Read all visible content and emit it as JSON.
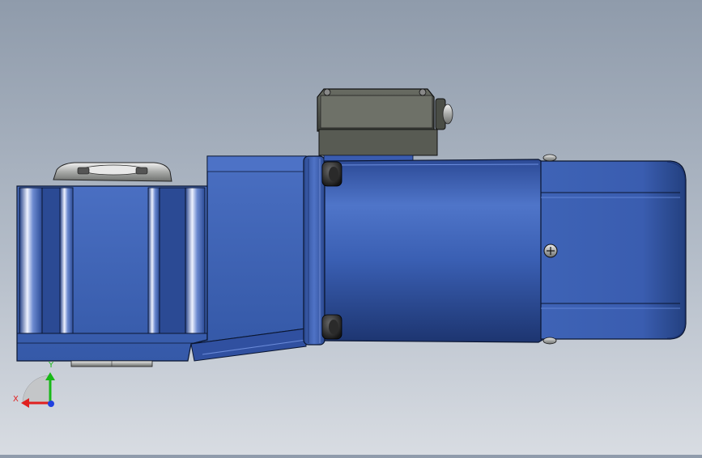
{
  "viewport": {
    "background_top": "#8f9bab",
    "background_bottom": "#d8dce2"
  },
  "model": {
    "body_color": "#3d63b8",
    "body_dark": "#233f80",
    "cover_color": "#5a5d55",
    "metal_color": "#c9cbcb"
  },
  "triad": {
    "x_label": "X",
    "y_label": "Y",
    "x_color": "#e02020",
    "y_color": "#18b818",
    "z_color": "#2040e0"
  }
}
